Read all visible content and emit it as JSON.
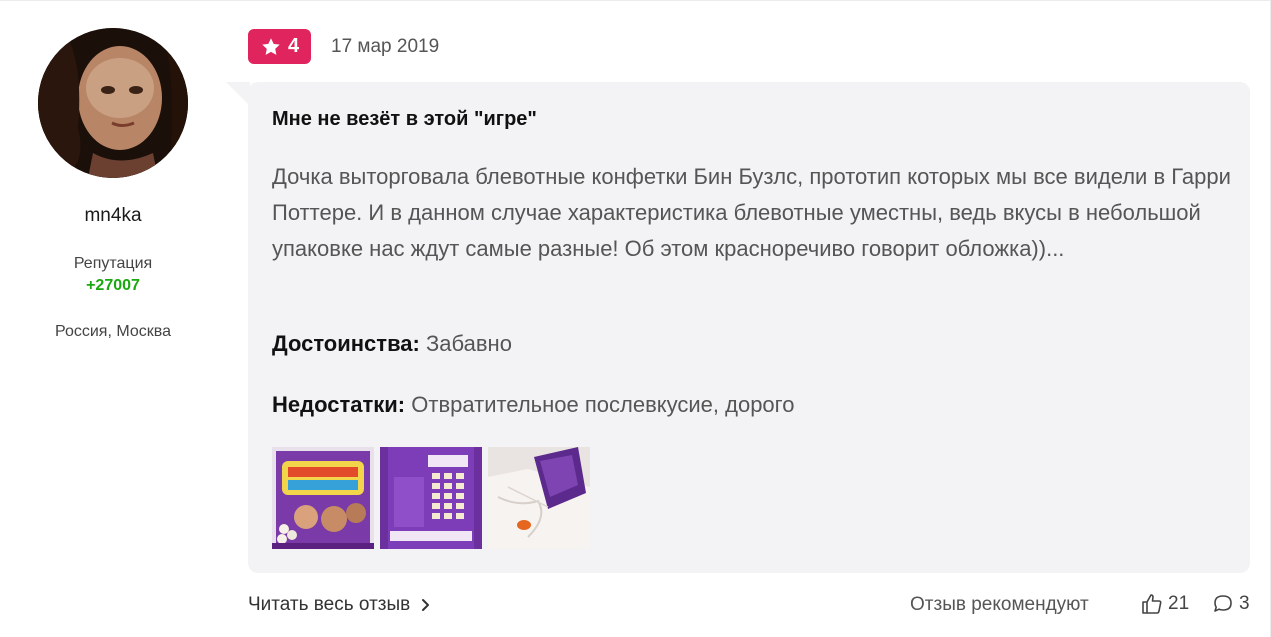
{
  "user": {
    "username": "mn4ka",
    "reputation_label": "Репутация",
    "reputation_value": "+27007",
    "location": "Россия, Москва"
  },
  "review": {
    "rating": "4",
    "date": "17 мар 2019",
    "title": "Мне не везёт в этой \"игре\"",
    "text": "Дочка выторговала блевотные конфетки Бин Бузлс, прототип которых мы все видели в Гарри Поттере. И в данном случае характеристика блевотные уместны, ведь вкусы в небольшой упаковке нас ждут самые разные! Об этом красноречиво говорит обложка))...",
    "pros_label": "Достоинства:",
    "pros_value": "Забавно",
    "cons_label": "Недостатки:",
    "cons_value": "Отвратительное послевкусие, дорого",
    "thumbnail_count": 3
  },
  "footer": {
    "read_more": "Читать весь отзыв",
    "recommend_label": "Отзыв рекомендуют",
    "likes": "21",
    "comments": "3"
  },
  "colors": {
    "rating_badge": "#e0245e",
    "reputation": "#1aa80f",
    "card_bg": "#f3f3f5"
  },
  "icons": {
    "rating": "star-icon",
    "read_more": "chevron-right-icon",
    "likes": "thumbs-up-icon",
    "comments": "comment-bubble-icon"
  }
}
